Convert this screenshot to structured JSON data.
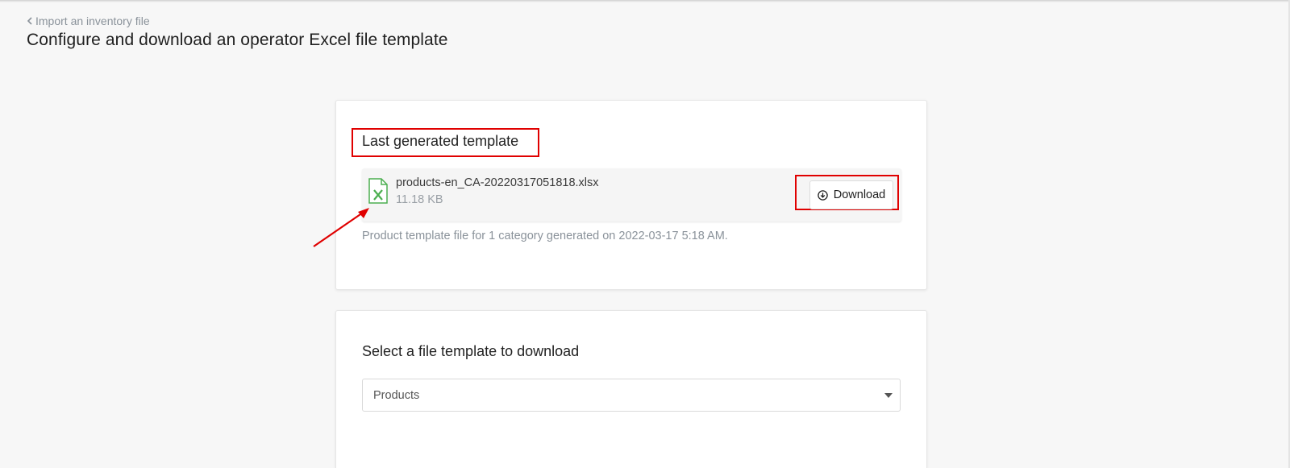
{
  "header": {
    "back_link_label": "Import an inventory file",
    "page_title": "Configure and download an operator Excel file template"
  },
  "last_generated": {
    "section_title": "Last generated template",
    "file_name": "products-en_CA-20220317051818.xlsx",
    "file_size": "11.18 KB",
    "file_icon": "excel-file-icon",
    "download_label": "Download",
    "download_icon": "download-circle-icon",
    "caption": "Product template file for 1 category generated on 2022-03-17 5:18 AM."
  },
  "select_template": {
    "section_title": "Select a file template to download",
    "selected_value": "Products",
    "caret_icon": "chevron-down-icon"
  },
  "colors": {
    "highlight": "#e00000",
    "excel_green": "#4caf50",
    "muted_text": "#8a929a",
    "page_bg": "#f7f7f7"
  }
}
